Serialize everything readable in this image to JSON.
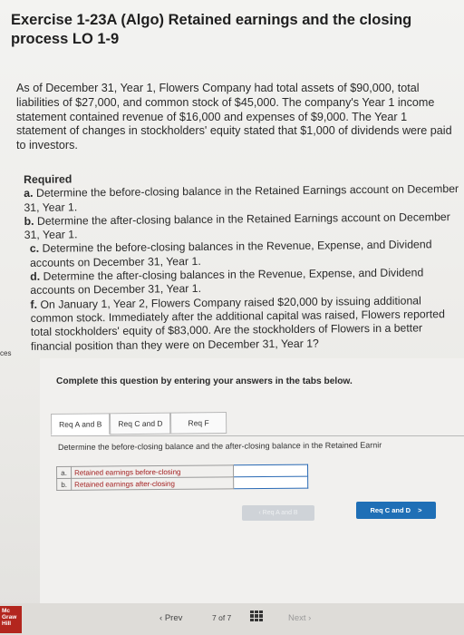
{
  "title": "Exercise 1-23A (Algo) Retained earnings and the closing process LO 1-9",
  "intro": "As of December 31, Year 1, Flowers Company had total assets of $90,000, total liabilities of $27,000, and common stock of $45,000. The company's Year 1 income statement contained revenue of $16,000 and expenses of $9,000. The Year 1 statement of changes in stockholders' equity stated that $1,000 of dividends were paid to investors.",
  "required": {
    "heading": "Required",
    "items": [
      {
        "letter": "a.",
        "text": "Determine the before-closing balance in the Retained Earnings account on December 31, Year 1."
      },
      {
        "letter": "b.",
        "text": "Determine the after-closing balance in the Retained Earnings account on December 31, Year 1."
      },
      {
        "letter": "c.",
        "text": "Determine the before-closing balances in the Revenue, Expense, and Dividend accounts on December 31, Year 1."
      },
      {
        "letter": "d.",
        "text": "Determine the after-closing balances in the Revenue, Expense, and Dividend accounts on December 31, Year 1."
      },
      {
        "letter": "f.",
        "text": "On January 1, Year 2, Flowers Company raised $20,000 by issuing additional common stock. Immediately after the additional capital was raised, Flowers reported total stockholders' equity of $83,000. Are the stockholders of Flowers in a better financial position than they were on December 31, Year 1?"
      }
    ]
  },
  "side_label": "ces",
  "instruction": "Complete this question by entering your answers in the tabs below.",
  "tabs": [
    {
      "label": "Req A and B"
    },
    {
      "label": "Req C and D"
    },
    {
      "label": "Req F"
    }
  ],
  "tab_instruction": "Determine the before-closing balance and the after-closing balance in the Retained Earnir",
  "answer_rows": [
    {
      "letter": "a.",
      "label": "Retained earnings before-closing",
      "value": ""
    },
    {
      "letter": "b.",
      "label": "Retained earnings after-closing",
      "value": ""
    }
  ],
  "nav": {
    "prev_tab": "Req A and B",
    "next_tab": "Req C and D",
    "next_tab_arrow": ">"
  },
  "footer": {
    "logo": "Mc Graw Hill",
    "prev": "Prev",
    "page": "7 of 7",
    "next": "Next"
  },
  "colors": {
    "accent": "#1f6fb6",
    "input_border": "#2a6ab5",
    "logo_red": "#b3261e"
  }
}
